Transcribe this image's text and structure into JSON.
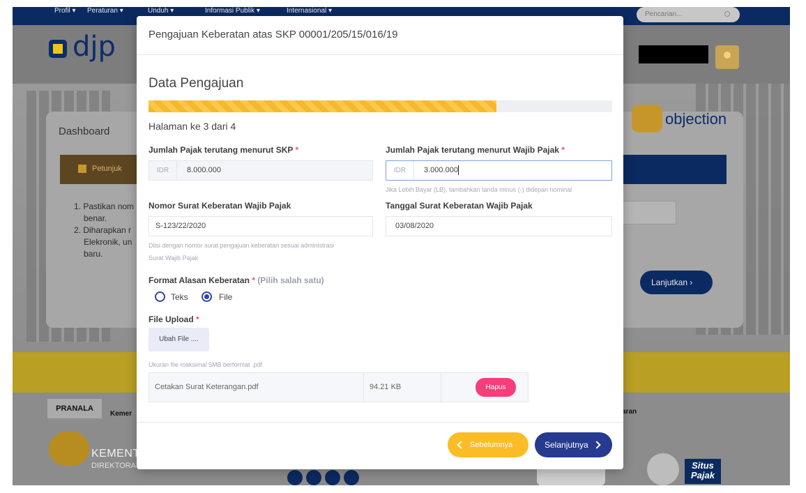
{
  "topnav": {
    "items": [
      "Profil ▾",
      "Peraturan ▾",
      "Unduh ▾",
      "Informasi Publik ▾",
      "Internasional ▾"
    ],
    "search_placeholder": "Pencarian..."
  },
  "header": {
    "logo": "djp"
  },
  "dashboard": {
    "title": "Dashboard",
    "petunjuk": "Petunjuk",
    "steps": [
      "1. Pastikan nom",
      "benar.",
      "2. Diharapkan r",
      "Elekronik, un",
      "baru."
    ],
    "next_button": "Lanjutkan",
    "eobjection_logo": "objection"
  },
  "footer": {
    "pranala": "PRANALA",
    "pranala_next": "Kemer",
    "pranala_right": "aran",
    "kemen_name": "KEMENT",
    "kemen_sub": "DIREKTORA",
    "situs": "Situs Pajak",
    "pajak_badge": "Pajak"
  },
  "modal": {
    "title": "Pengajuan Keberatan atas SKP 00001/205/15/016/19",
    "section_title": "Data Pengajuan",
    "progress_fraction": 0.75,
    "page_text": "Halaman ke 3 dari 4",
    "fields": {
      "pajak_skp": {
        "label": "Jumlah Pajak terutang menurut SKP",
        "required": "*",
        "addon": "IDR",
        "value": "8.000.000"
      },
      "pajak_wp": {
        "label": "Jumlah Pajak terutang menurut Wajib Pajak",
        "required": "*",
        "addon": "IDR",
        "value": "3.000.000",
        "hint": "Jika Lebih Bayar (LB), tambahkan tanda minus (-) didepan nominal"
      },
      "nomor_surat": {
        "label": "Nomor Surat Keberatan Wajib Pajak",
        "value": "S-123/22/2020",
        "hint_line1": "Diisi dengan nomor surat pengajuan keberatan sesuai administrasi",
        "hint_line2": "Surat Wajib Pajak"
      },
      "tanggal_surat": {
        "label": "Tanggal Surat Keberatan Wajib Pajak",
        "value": "03/08/2020"
      },
      "format_alasan": {
        "label": "Format Alasan Keberatan",
        "required": "*",
        "optional_note": "(Pilih salah satu)",
        "options": [
          "Teks",
          "File"
        ],
        "selected": "File"
      },
      "file_upload": {
        "label": "File Upload",
        "required": "*",
        "button": "Ubah File ....",
        "hint": "Ukuran file maksimal 5MB berformat .pdf",
        "file_name": "Cetakan Surat Keterangan.pdf",
        "file_size": "94.21 KB",
        "delete_button": "Hapus"
      }
    },
    "buttons": {
      "prev": "Sebelumnya",
      "next": "Selanjutnya"
    }
  },
  "colors": {
    "navy": "#0b2a61",
    "accent_yellow": "#fbbd26",
    "button_blue": "#263a8f",
    "danger_pink": "#f53e7a",
    "radio_blue": "#2e43b0",
    "required_red": "#f0506e"
  }
}
